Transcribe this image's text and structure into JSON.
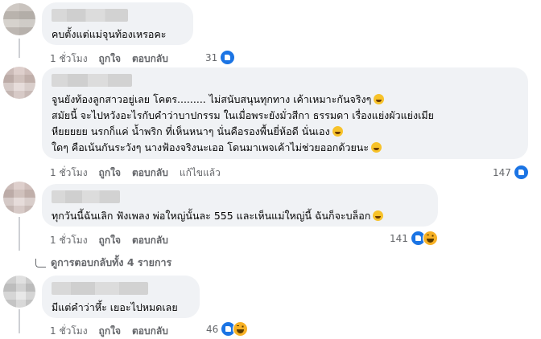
{
  "comments": [
    {
      "text_lines": [
        "คบตั้งแต่แม่จุนท้องเหรอคะ"
      ],
      "actions": {
        "time": "1 ชั่วโมง",
        "like": "ถูกใจ",
        "reply": "ตอบกลับ"
      },
      "reaction_count": "31",
      "reactions": [
        "like-icon"
      ]
    },
    {
      "text_lines": [
        "จูนยังท้องลูกสาวอยู่เลย โคตร......... ไม่สนับสนุนทุกทาง เค้าเหมาะกันจริงๆ",
        "สมัยนี้ จะไปหวังอะไรกับคำว่าบาปกรรม ในเมื่อพระยังมั่วสีกา ธรรมดา เรื่องแย่งผัวแย่งเมีย",
        "หียยยยย นรกก็แค่ น้ำพริก ที่เห็นหนาๆ นั่นคือรองพื้นยี่ห้อดี นั่นเอง",
        "ใดๆ คือเน้นกันระวังๆ นางฟ้องจริงนะเออ โดนมาเพจเค้าไม่ช่วยออกด้วยนะ"
      ],
      "actions": {
        "time": "1 ชั่วโมง",
        "like": "ถูกใจ",
        "reply": "ตอบกลับ",
        "edited": "แก้ไขแล้ว"
      },
      "reaction_count": "147",
      "reactions": [
        "like-icon"
      ]
    },
    {
      "text_lines": [
        "ทุกวันนี้ฉันเลิก ฟังเพลง พ่อใหญ่นั้นละ 555 และเห็นแม่ใหญ่นี้ ฉันก็จะบล็อก"
      ],
      "actions": {
        "time": "1 ชั่วโมง",
        "like": "ถูกใจ",
        "reply": "ตอบกลับ"
      },
      "reaction_count": "141",
      "reactions": [
        "like-icon",
        "haha-icon"
      ]
    },
    {
      "text_lines": [
        "มีแต่คำว่าหึ้ะ เยอะไปหมดเลย"
      ],
      "actions": {
        "time": "1 ชั่วโมง",
        "like": "ถูกใจ",
        "reply": "ตอบกลับ"
      },
      "reaction_count": "46",
      "reactions": [
        "like-icon",
        "haha-icon"
      ]
    }
  ],
  "view_replies": "ดูการตอบกลับทั้ง 4 รายการ",
  "colors": {
    "bubble": "#f0f2f5",
    "meta": "#65676b",
    "like_blue": "#1b74e4",
    "haha_yellow": "#f7b125"
  }
}
